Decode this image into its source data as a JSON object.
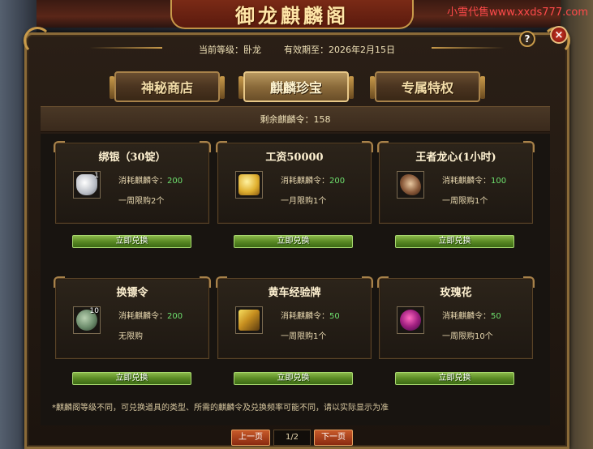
{
  "title": "御龙麒麟阁",
  "watermark": "小雪代售www.xxds777.com",
  "help_label": "?",
  "close_label": "×",
  "status": {
    "level": "当前等级：卧龙",
    "expiry": "有效期至：2026年2月15日"
  },
  "tabs": [
    {
      "label": "神秘商店",
      "active": false
    },
    {
      "label": "麒麟珍宝",
      "active": true
    },
    {
      "label": "专属特权",
      "active": false
    }
  ],
  "remaining_tokens": "剩余麒麟令：158",
  "items": [
    {
      "name": "绑银（30锭）",
      "qty": "1",
      "cost_label": "消耗麒麟令：",
      "cost": "200",
      "limit": "一周限购2个",
      "icon": "silver-ingot-icon",
      "redeem_label": "立即兑换"
    },
    {
      "name": "工资50000",
      "qty": "",
      "cost_label": "消耗麒麟令：",
      "cost": "200",
      "limit": "一月限购1个",
      "icon": "gold-stack-icon",
      "redeem_label": "立即兑换"
    },
    {
      "name": "王者龙心(1小时)",
      "qty": "",
      "cost_label": "消耗麒麟令：",
      "cost": "100",
      "limit": "一周限购1个",
      "icon": "dragon-heart-icon",
      "redeem_label": "立即兑换"
    },
    {
      "name": "换镖令",
      "qty": "10",
      "cost_label": "消耗麒麟令：",
      "cost": "200",
      "limit": "无限购",
      "icon": "escort-token-icon",
      "redeem_label": "立即兑换"
    },
    {
      "name": "黄车经验牌",
      "qty": "",
      "cost_label": "消耗麒麟令：",
      "cost": "50",
      "limit": "一周限购1个",
      "icon": "yellow-cart-exp-icon",
      "redeem_label": "立即兑换"
    },
    {
      "name": "玫瑰花",
      "qty": "",
      "cost_label": "消耗麒麟令：",
      "cost": "50",
      "limit": "一周限购10个",
      "icon": "rose-icon",
      "redeem_label": "立即兑换"
    }
  ],
  "note": "*麒麟阁等级不同，可兑换道具的类型、所需的麒麟令及兑换频率可能不同，请以实际显示为准",
  "pager": {
    "prev_label": "上一页",
    "page": "1/2",
    "next_label": "下一页"
  },
  "colors": {
    "accent_gold": "#c89a4a",
    "cost_green": "#6ee06e",
    "redeem_green": "#5a8a24",
    "pager_red": "#8a2a10"
  }
}
